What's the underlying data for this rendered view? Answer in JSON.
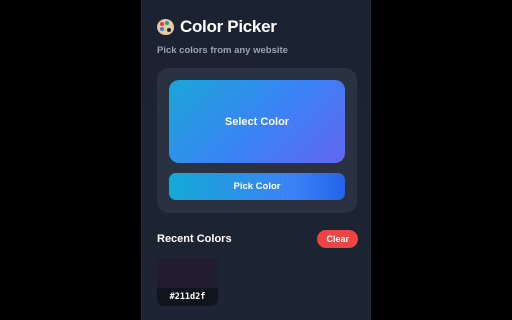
{
  "header": {
    "title": "Color Picker",
    "subtitle": "Pick colors from any website",
    "icon": "palette-icon"
  },
  "picker": {
    "select_label": "Select Color",
    "pick_button_label": "Pick Color"
  },
  "recent": {
    "title": "Recent Colors",
    "clear_label": "Clear",
    "colors": [
      {
        "hex": "#211d2f",
        "label": "#211d2f"
      }
    ]
  },
  "colors": {
    "background": "#1b2231",
    "card": "#2a3140",
    "accent_start": "#1ba6d6",
    "accent_end": "#6366f1",
    "clear": "#ef4444"
  }
}
